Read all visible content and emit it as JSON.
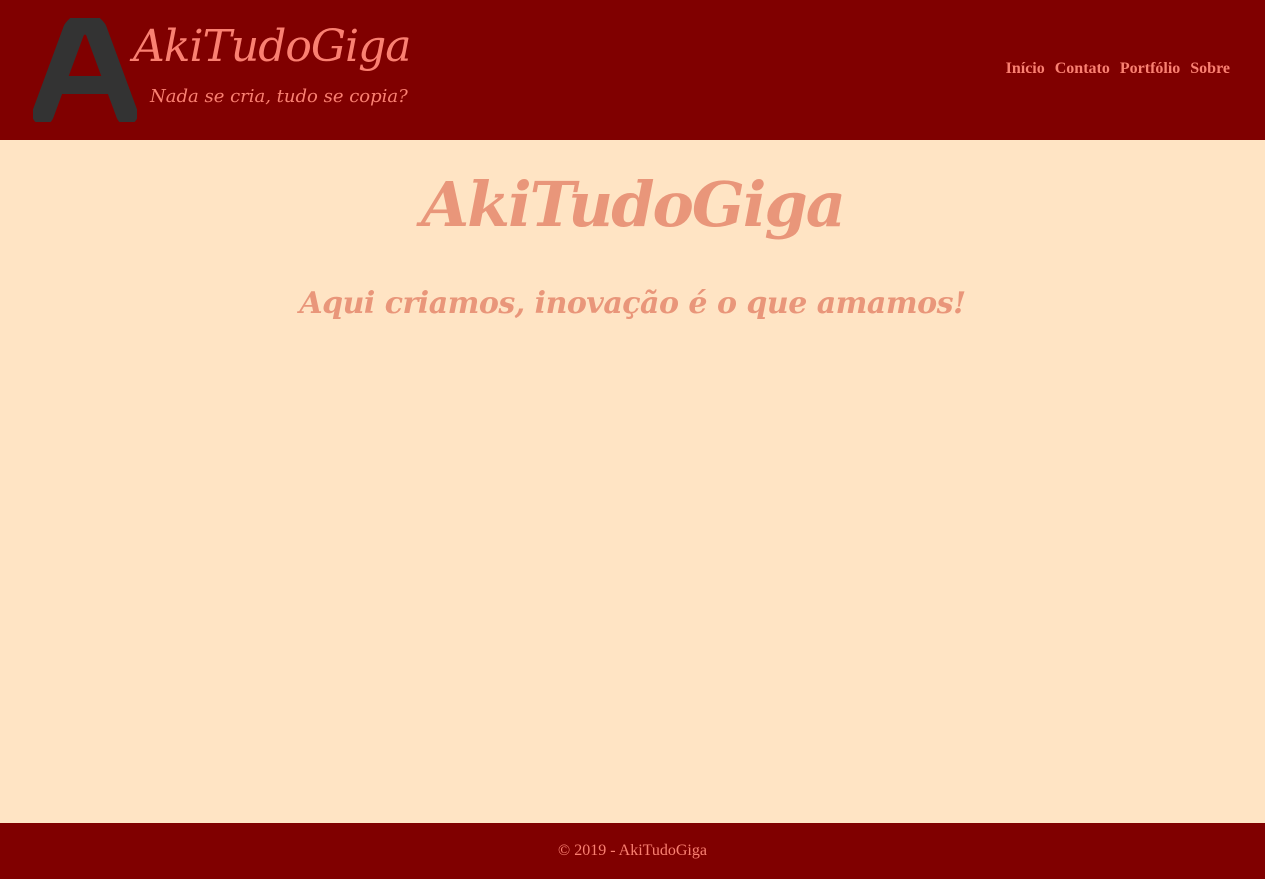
{
  "colors": {
    "header_bg": "#800000",
    "page_bg": "#ffe4c4",
    "brand_text": "#fa8072",
    "hero_text": "#e9967a",
    "logo_fill": "#333333"
  },
  "header": {
    "logo_icon": "letter-a-logo-icon",
    "title": "AkiTudoGiga",
    "slogan": "Nada se cria, tudo se copia?"
  },
  "nav": {
    "items": [
      {
        "label": "Início"
      },
      {
        "label": "Contato"
      },
      {
        "label": "Portfólio"
      },
      {
        "label": "Sobre"
      }
    ]
  },
  "main": {
    "title": "AkiTudoGiga",
    "subtitle": "Aqui criamos, inovação é o que amamos!"
  },
  "footer": {
    "copyright": "© 2019 - AkiTudoGiga"
  }
}
